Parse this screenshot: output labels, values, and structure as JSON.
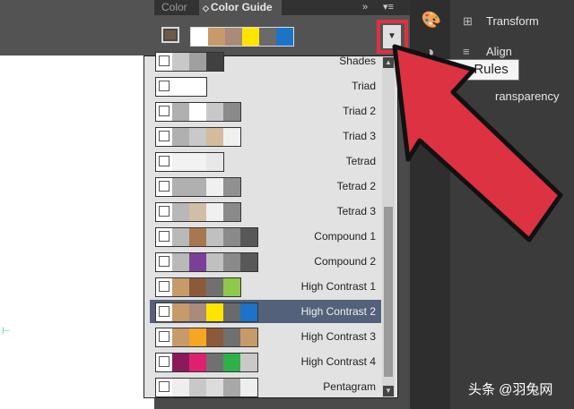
{
  "panel": {
    "tab_color": "Color",
    "tab_color_guide": "Color Guide",
    "tab_guide_arrow": "◇",
    "forward_icon": "»",
    "menu_icon": "▾≡"
  },
  "colors": {
    "base": "#6e5a46",
    "current_harmony": [
      "#ffffff",
      "#c79a6a",
      "#a88b7a",
      "#ffe400",
      "#6a6a6a",
      "#1d73c8"
    ]
  },
  "dropdown_arrow": "▼",
  "harmony_rules": [
    {
      "label": "Shades",
      "swatches": [
        "#ffffff",
        "#c8c8c8",
        "#a0a0a0",
        "#404040"
      ]
    },
    {
      "label": "Triad",
      "swatches": [
        "#ffffff",
        "#ffffff",
        "#ffffff"
      ]
    },
    {
      "label": "Triad 2",
      "swatches": [
        "#ffffff",
        "#b0b0b0",
        "#ffffff",
        "#c8c8c8",
        "#8a8a8a"
      ]
    },
    {
      "label": "Triad 3",
      "swatches": [
        "#ffffff",
        "#b0b0b0",
        "#c9c9c9",
        "#d4bb9e",
        "#f0f0f0"
      ]
    },
    {
      "label": "Tetrad",
      "swatches": [
        "#ffffff",
        "#f2f2f2",
        "#f2f2f2",
        "#e8e8e8"
      ]
    },
    {
      "label": "Tetrad 2",
      "swatches": [
        "#ffffff",
        "#b0b0b0",
        "#b0b0b0",
        "#f0f0f0",
        "#909090"
      ]
    },
    {
      "label": "Tetrad 3",
      "swatches": [
        "#ffffff",
        "#b8b8b8",
        "#d2bea4",
        "#f0f0f0",
        "#8a8a8a"
      ]
    },
    {
      "label": "Compound 1",
      "swatches": [
        "#ffffff",
        "#b9b9b9",
        "#a9774f",
        "#c0c0c0",
        "#8a8a8a",
        "#585858"
      ]
    },
    {
      "label": "Compound 2",
      "swatches": [
        "#ffffff",
        "#b9b9b9",
        "#7b3f9a",
        "#c0c0c0",
        "#8a8a8a",
        "#585858"
      ]
    },
    {
      "label": "High Contrast 1",
      "swatches": [
        "#ffffff",
        "#c79a6a",
        "#8b5a3a",
        "#707070",
        "#8fc84a"
      ]
    },
    {
      "label": "High Contrast 2",
      "swatches": [
        "#ffffff",
        "#c79a6a",
        "#a88b7a",
        "#ffe400",
        "#6a6a6a",
        "#1d73c8"
      ]
    },
    {
      "label": "High Contrast 3",
      "swatches": [
        "#ffffff",
        "#c79a6a",
        "#f5a623",
        "#8b5a3a",
        "#707070",
        "#c79a6a"
      ]
    },
    {
      "label": "High Contrast 4",
      "swatches": [
        "#ffffff",
        "#8a1a5a",
        "#e0206e",
        "#707070",
        "#2fb14a",
        "#c9c9c9"
      ]
    },
    {
      "label": "Pentagram",
      "swatches": [
        "#ffffff",
        "#eeeeee",
        "#c8c8c8",
        "#dcdcdc",
        "#a8a8a8",
        "#eeeeee"
      ]
    }
  ],
  "selected_index": 10,
  "scroll_up_icon": "▲",
  "scroll_down_icon": "▼",
  "tooltip": "ony Rules",
  "dock": {
    "icons": [
      "◐",
      "🎨",
      "◑",
      "◧"
    ],
    "items": [
      "Transform",
      "Align",
      "ransparency"
    ],
    "item_icons": [
      "⊞",
      "≡",
      "◫"
    ]
  },
  "artboard_mark": "⊢",
  "watermark": "头条 @羽兔网"
}
